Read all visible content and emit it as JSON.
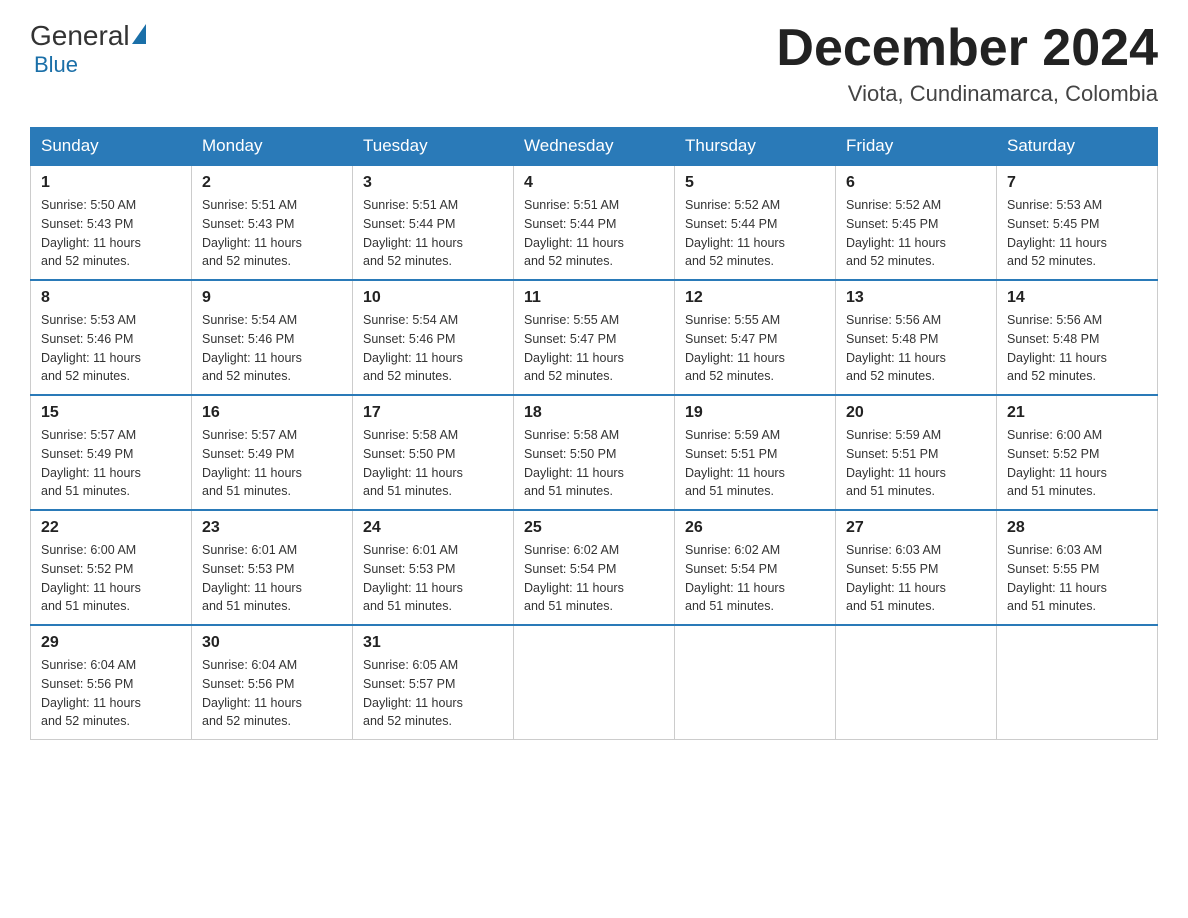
{
  "header": {
    "logo": {
      "general": "General",
      "blue": "Blue"
    },
    "title": "December 2024",
    "location": "Viota, Cundinamarca, Colombia"
  },
  "days_of_week": [
    "Sunday",
    "Monday",
    "Tuesday",
    "Wednesday",
    "Thursday",
    "Friday",
    "Saturday"
  ],
  "weeks": [
    [
      {
        "day": "1",
        "sunrise": "5:50 AM",
        "sunset": "5:43 PM",
        "daylight": "11 hours and 52 minutes."
      },
      {
        "day": "2",
        "sunrise": "5:51 AM",
        "sunset": "5:43 PM",
        "daylight": "11 hours and 52 minutes."
      },
      {
        "day": "3",
        "sunrise": "5:51 AM",
        "sunset": "5:44 PM",
        "daylight": "11 hours and 52 minutes."
      },
      {
        "day": "4",
        "sunrise": "5:51 AM",
        "sunset": "5:44 PM",
        "daylight": "11 hours and 52 minutes."
      },
      {
        "day": "5",
        "sunrise": "5:52 AM",
        "sunset": "5:44 PM",
        "daylight": "11 hours and 52 minutes."
      },
      {
        "day": "6",
        "sunrise": "5:52 AM",
        "sunset": "5:45 PM",
        "daylight": "11 hours and 52 minutes."
      },
      {
        "day": "7",
        "sunrise": "5:53 AM",
        "sunset": "5:45 PM",
        "daylight": "11 hours and 52 minutes."
      }
    ],
    [
      {
        "day": "8",
        "sunrise": "5:53 AM",
        "sunset": "5:46 PM",
        "daylight": "11 hours and 52 minutes."
      },
      {
        "day": "9",
        "sunrise": "5:54 AM",
        "sunset": "5:46 PM",
        "daylight": "11 hours and 52 minutes."
      },
      {
        "day": "10",
        "sunrise": "5:54 AM",
        "sunset": "5:46 PM",
        "daylight": "11 hours and 52 minutes."
      },
      {
        "day": "11",
        "sunrise": "5:55 AM",
        "sunset": "5:47 PM",
        "daylight": "11 hours and 52 minutes."
      },
      {
        "day": "12",
        "sunrise": "5:55 AM",
        "sunset": "5:47 PM",
        "daylight": "11 hours and 52 minutes."
      },
      {
        "day": "13",
        "sunrise": "5:56 AM",
        "sunset": "5:48 PM",
        "daylight": "11 hours and 52 minutes."
      },
      {
        "day": "14",
        "sunrise": "5:56 AM",
        "sunset": "5:48 PM",
        "daylight": "11 hours and 52 minutes."
      }
    ],
    [
      {
        "day": "15",
        "sunrise": "5:57 AM",
        "sunset": "5:49 PM",
        "daylight": "11 hours and 51 minutes."
      },
      {
        "day": "16",
        "sunrise": "5:57 AM",
        "sunset": "5:49 PM",
        "daylight": "11 hours and 51 minutes."
      },
      {
        "day": "17",
        "sunrise": "5:58 AM",
        "sunset": "5:50 PM",
        "daylight": "11 hours and 51 minutes."
      },
      {
        "day": "18",
        "sunrise": "5:58 AM",
        "sunset": "5:50 PM",
        "daylight": "11 hours and 51 minutes."
      },
      {
        "day": "19",
        "sunrise": "5:59 AM",
        "sunset": "5:51 PM",
        "daylight": "11 hours and 51 minutes."
      },
      {
        "day": "20",
        "sunrise": "5:59 AM",
        "sunset": "5:51 PM",
        "daylight": "11 hours and 51 minutes."
      },
      {
        "day": "21",
        "sunrise": "6:00 AM",
        "sunset": "5:52 PM",
        "daylight": "11 hours and 51 minutes."
      }
    ],
    [
      {
        "day": "22",
        "sunrise": "6:00 AM",
        "sunset": "5:52 PM",
        "daylight": "11 hours and 51 minutes."
      },
      {
        "day": "23",
        "sunrise": "6:01 AM",
        "sunset": "5:53 PM",
        "daylight": "11 hours and 51 minutes."
      },
      {
        "day": "24",
        "sunrise": "6:01 AM",
        "sunset": "5:53 PM",
        "daylight": "11 hours and 51 minutes."
      },
      {
        "day": "25",
        "sunrise": "6:02 AM",
        "sunset": "5:54 PM",
        "daylight": "11 hours and 51 minutes."
      },
      {
        "day": "26",
        "sunrise": "6:02 AM",
        "sunset": "5:54 PM",
        "daylight": "11 hours and 51 minutes."
      },
      {
        "day": "27",
        "sunrise": "6:03 AM",
        "sunset": "5:55 PM",
        "daylight": "11 hours and 51 minutes."
      },
      {
        "day": "28",
        "sunrise": "6:03 AM",
        "sunset": "5:55 PM",
        "daylight": "11 hours and 51 minutes."
      }
    ],
    [
      {
        "day": "29",
        "sunrise": "6:04 AM",
        "sunset": "5:56 PM",
        "daylight": "11 hours and 52 minutes."
      },
      {
        "day": "30",
        "sunrise": "6:04 AM",
        "sunset": "5:56 PM",
        "daylight": "11 hours and 52 minutes."
      },
      {
        "day": "31",
        "sunrise": "6:05 AM",
        "sunset": "5:57 PM",
        "daylight": "11 hours and 52 minutes."
      },
      null,
      null,
      null,
      null
    ]
  ],
  "labels": {
    "sunrise": "Sunrise:",
    "sunset": "Sunset:",
    "daylight": "Daylight:"
  }
}
